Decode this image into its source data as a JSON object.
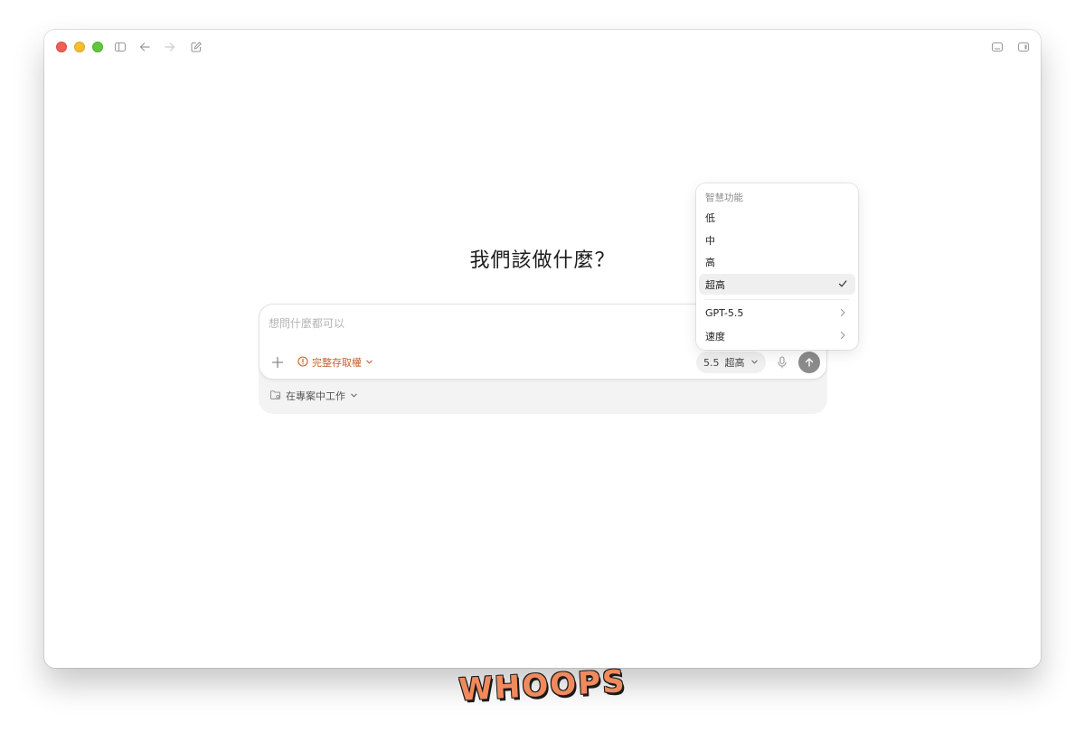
{
  "heading": "我們該做什麼？",
  "composer": {
    "placeholder": "想問什麼都可以",
    "access_label": "完整存取權",
    "model_version": "5.5",
    "model_level": "超高",
    "project_label": "在專案中工作"
  },
  "menu": {
    "header": "智慧功能",
    "items": [
      {
        "label": "低"
      },
      {
        "label": "中"
      },
      {
        "label": "高"
      },
      {
        "label": "超高",
        "selected": true
      }
    ],
    "submenus": [
      {
        "label": "GPT-5.5"
      },
      {
        "label": "速度"
      }
    ]
  },
  "watermark": "WHOOPS",
  "colors": {
    "accent": "#c5612b",
    "send_button": "#8b8b8b",
    "watermark": "#f08a5d"
  }
}
